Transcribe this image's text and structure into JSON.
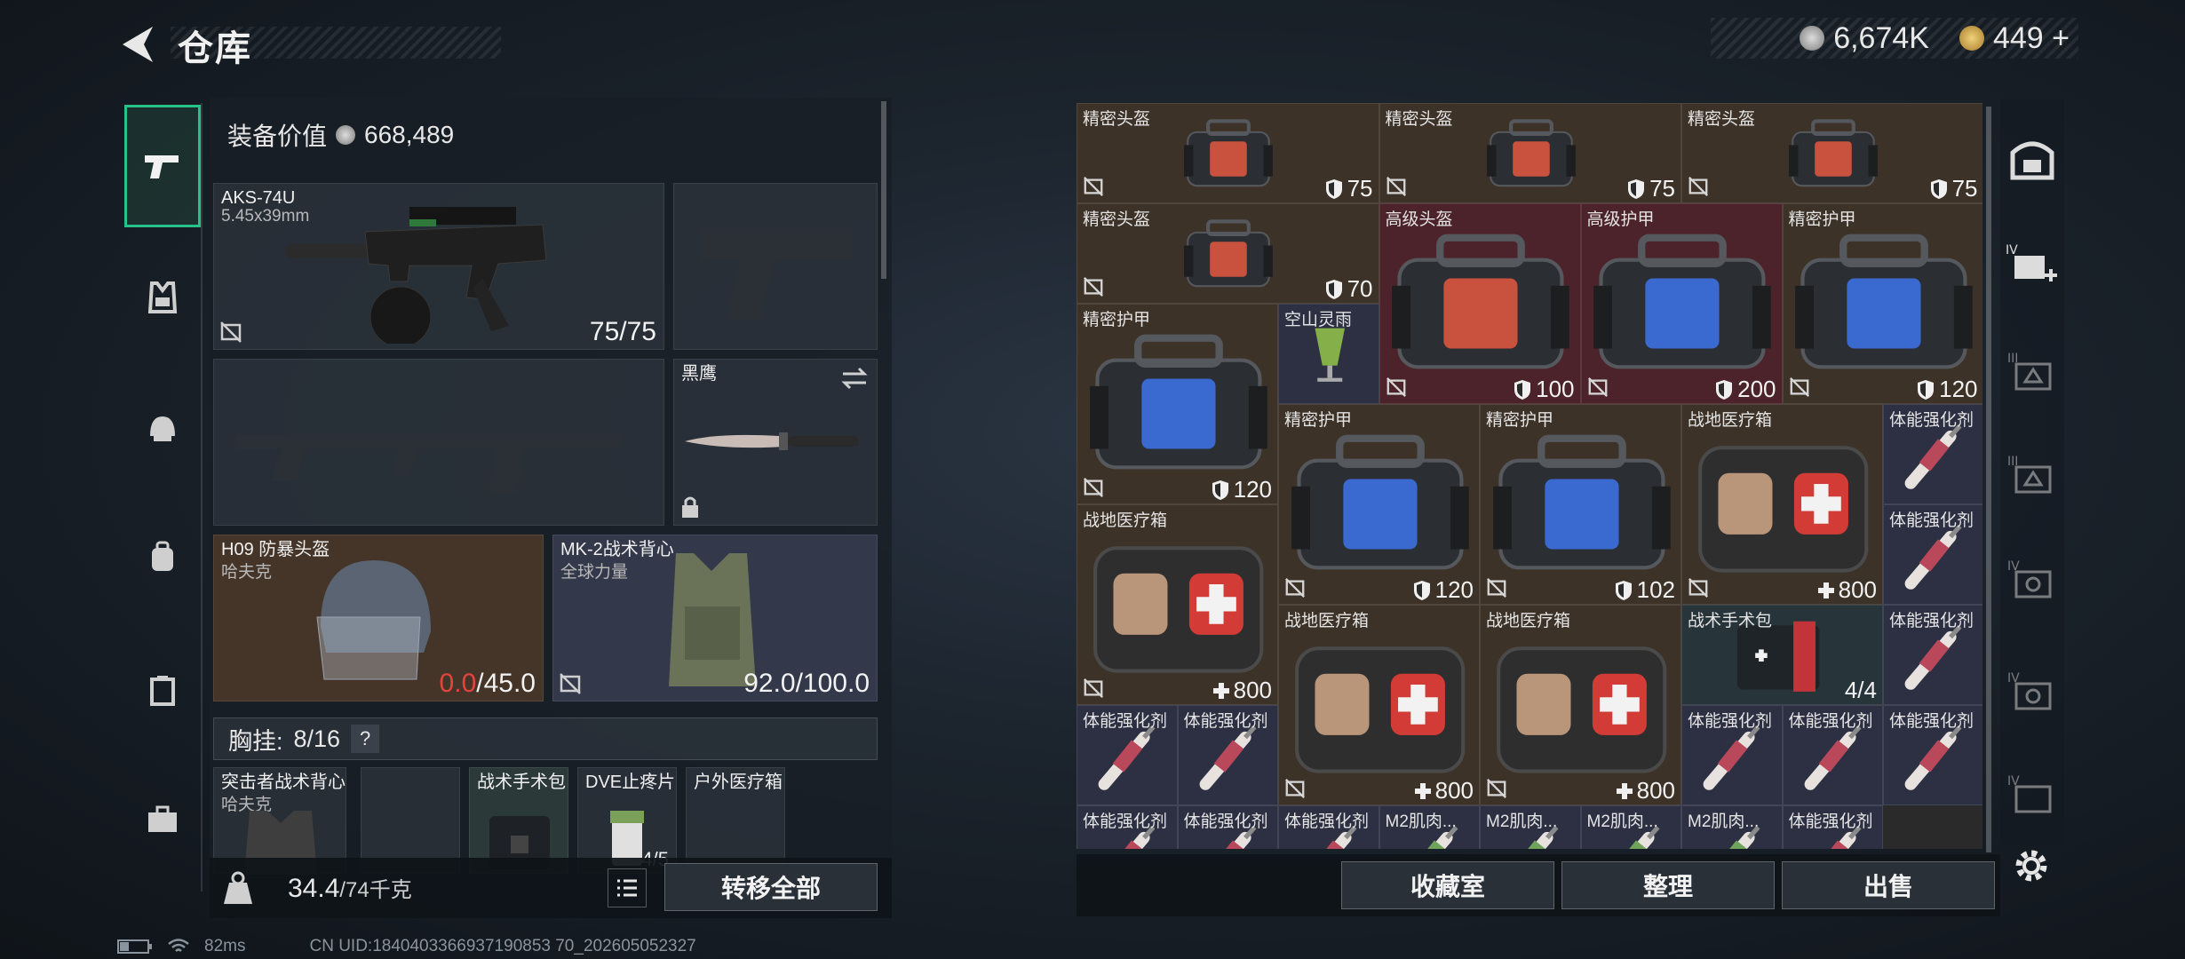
{
  "header": {
    "title": "仓库",
    "currency_1": "6,674K",
    "currency_2": "449 +"
  },
  "loadout": {
    "value_label": "装备价值",
    "value": "668,489",
    "primary": {
      "name": "AKS-74U",
      "ammo": "5.45x39mm",
      "count": "75/75"
    },
    "melee": {
      "name": "黑鹰"
    },
    "helmet": {
      "name": "H09 防暴头盔",
      "brand": "哈夫克",
      "durability_current": "0.0",
      "durability_max": "/45.0"
    },
    "armor": {
      "name": "MK-2战术背心",
      "brand": "全球力量",
      "durability": "92.0/100.0"
    },
    "rig": {
      "label": "胸挂:",
      "capacity": "8/16",
      "help": "?"
    },
    "rig_items": [
      {
        "name": "突击者战术背心",
        "brand": "哈夫克"
      },
      {
        "name": "战术手术包"
      },
      {
        "name": "DVE止疼片",
        "count": "4/5"
      },
      {
        "name": "户外医疗箱"
      }
    ],
    "weight": "34.4",
    "weight_max": "/74千克",
    "transfer_all": "转移全部"
  },
  "stash": {
    "items": [
      {
        "label": "精密头盔",
        "value": "75",
        "kind": "shield"
      },
      {
        "label": "精密头盔",
        "value": "75",
        "kind": "shield"
      },
      {
        "label": "精密头盔",
        "value": "75",
        "kind": "shield"
      },
      {
        "label": "精密头盔",
        "value": "70",
        "kind": "shield"
      },
      {
        "label": "高级头盔",
        "value": "100",
        "kind": "shield"
      },
      {
        "label": "高级护甲",
        "value": "200",
        "kind": "shield"
      },
      {
        "label": "精密护甲",
        "value": "120",
        "kind": "shield"
      },
      {
        "label": "精密护甲",
        "value": "120",
        "kind": "shield"
      },
      {
        "label": "空山灵雨"
      },
      {
        "label": "精密护甲",
        "value": "120",
        "kind": "shield"
      },
      {
        "label": "精密护甲",
        "value": "102",
        "kind": "shield"
      },
      {
        "label": "战地医疗箱",
        "value": "800",
        "kind": "plus"
      },
      {
        "label": "体能强化剂"
      },
      {
        "label": "战地医疗箱",
        "value": "800",
        "kind": "plus"
      },
      {
        "label": "体能强化剂"
      },
      {
        "label": "战地医疗箱",
        "value": "800",
        "kind": "plus"
      },
      {
        "label": "战地医疗箱",
        "value": "800",
        "kind": "plus"
      },
      {
        "label": "战术手术包",
        "value": "4/4"
      },
      {
        "label": "体能强化剂"
      },
      {
        "label": "体能强化剂"
      },
      {
        "label": "体能强化剂"
      },
      {
        "label": "体能强化剂"
      },
      {
        "label": "体能强化剂"
      },
      {
        "label": "体能强化剂"
      },
      {
        "label": "体能强化剂"
      },
      {
        "label": "体能强化剂"
      },
      {
        "label": "体能强化剂"
      },
      {
        "label": "M2肌肉..."
      },
      {
        "label": "M2肌肉..."
      },
      {
        "label": "M2肌肉..."
      },
      {
        "label": "M2肌肉..."
      },
      {
        "label": "体能强化剂"
      }
    ]
  },
  "bottom_buttons": [
    "收藏室",
    "整理",
    "出售"
  ],
  "status": {
    "ping": "82ms",
    "uid": "CN UID:1840403366937190853 70_202605052327"
  },
  "colors": {
    "accent_green": "#27c28a",
    "loss_red": "#e0463e",
    "bag_blue": "#3a6ad0",
    "bag_red": "#c8523e"
  }
}
